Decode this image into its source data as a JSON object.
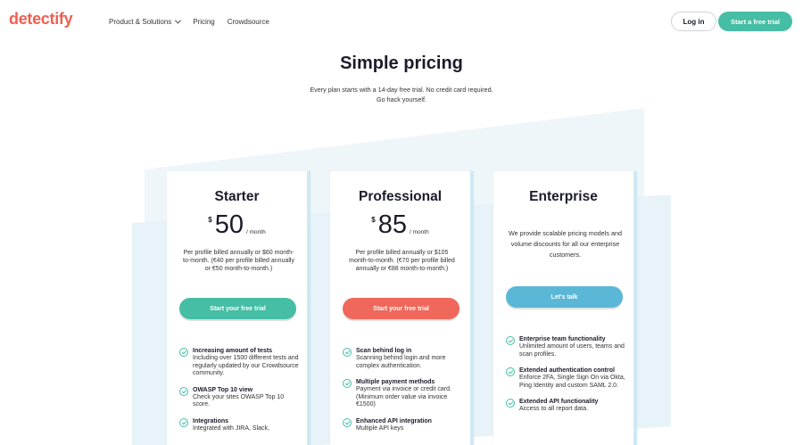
{
  "header": {
    "logo": "detectify",
    "nav": [
      "Product & Solutions",
      "Pricing",
      "Crowdsource"
    ],
    "login": "Log in",
    "trial": "Start a free trial"
  },
  "hero": {
    "title": "Simple pricing",
    "line1": "Every plan starts with a 14-day free trial. No credit card required.",
    "line2": "Go hack yourself."
  },
  "plans": [
    {
      "name": "Starter",
      "currency": "$",
      "amount": "50",
      "per": "/ month",
      "billing": "Per profile billed annually or $60 month-to-month. (€40 per profile billed annually or €50 month-to-month.)",
      "cta": "Start your free trial",
      "features": [
        {
          "title": "Increasing amount of tests",
          "desc": "Including over 1500 different tests and regularly updated by our Crowdsource community."
        },
        {
          "title": "OWASP Top 10 view",
          "desc": "Check your sites OWASP Top 10 score."
        },
        {
          "title": "Integrations",
          "desc": "Integrated with JIRA, Slack,"
        }
      ]
    },
    {
      "name": "Professional",
      "currency": "$",
      "amount": "85",
      "per": "/ month",
      "billing": "Per profile billed annually or $105 month-to-month. (€70 per profile billed annually or €88 month-to-month.)",
      "cta": "Start your free trial",
      "features": [
        {
          "title": "Scan behind log in",
          "desc": "Scanning behind login and more complex authentication."
        },
        {
          "title": "Multiple payment methods",
          "desc": "Payment via invoice or credit card. (Minimum order value via invoice €1500)"
        },
        {
          "title": "Enhanced API integration",
          "desc": "Multiple API keys"
        }
      ]
    },
    {
      "name": "Enterprise",
      "description": "We provide scalable pricing models and volume discounts for all our enterprise customers.",
      "cta": "Let's talk",
      "features": [
        {
          "title": "Enterprise team functionality",
          "desc": "Unlimited amount of users, teams and scan profiles."
        },
        {
          "title": "Extended authentication control",
          "desc": "Enforce 2FA, Single Sign On via Okta, Ping Identity and custom SAML 2.0."
        },
        {
          "title": "Extended API functionality",
          "desc": "Access to all report data."
        }
      ]
    }
  ]
}
